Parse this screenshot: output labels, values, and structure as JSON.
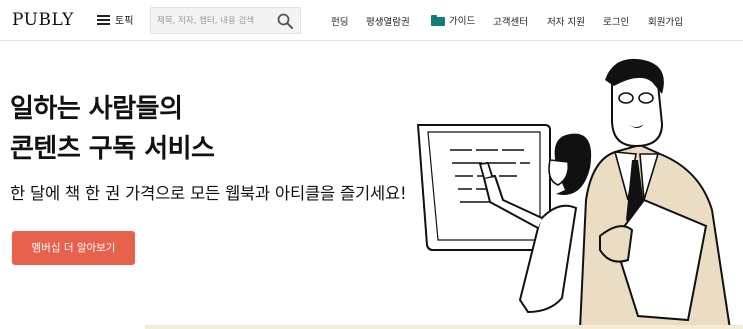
{
  "header": {
    "logo": "PUBLY",
    "topic_label": "토픽",
    "search_placeholder": "제목, 저자, 챕터, 내용 검색",
    "nav": {
      "funding": "펀딩",
      "lifetime_pass": "평생열람권",
      "guide": "가이드",
      "customer_center": "고객센터",
      "author_support": "저자 지원",
      "login": "로그인",
      "signup": "회원가입"
    }
  },
  "hero": {
    "title_line1": "일하는 사람들의",
    "title_line2": "콘텐츠 구독 서비스",
    "subtitle": "한 달에 책 한 권 가격으로 모든 웹북과 아티클을 즐기세요!",
    "cta_label": "멤버십 더 알아보기"
  },
  "colors": {
    "cta": "#e8614c",
    "folder_icon": "#127c7c",
    "illustration_beige": "#ebdcc4"
  },
  "icons": [
    "hamburger-icon",
    "search-icon",
    "folder-icon"
  ]
}
